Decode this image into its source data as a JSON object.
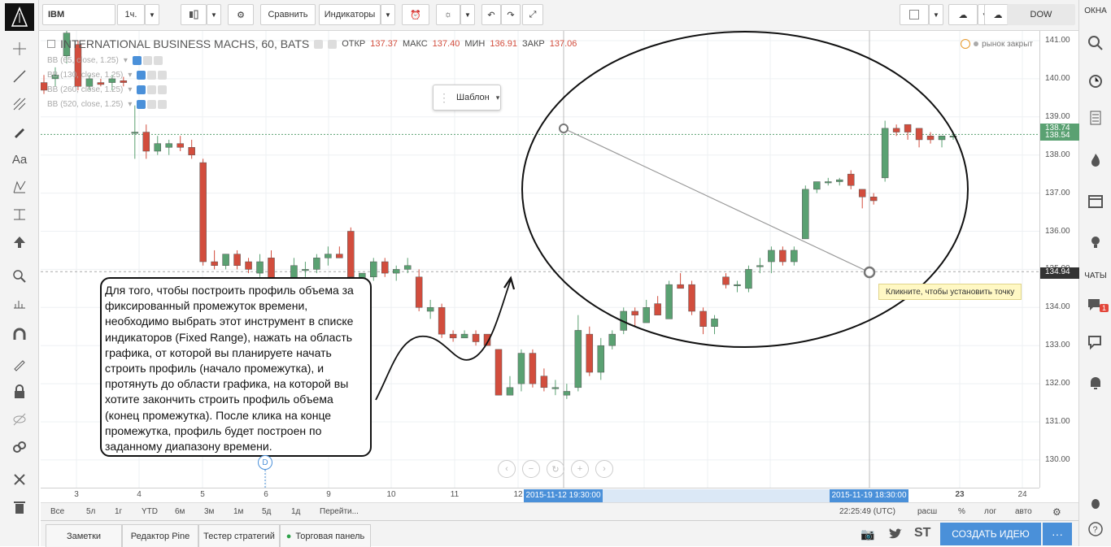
{
  "toolbar": {
    "symbol": "IBM",
    "interval": "1ч.",
    "compare": "Сравнить",
    "indicators": "Индикаторы",
    "exchange": "DOW"
  },
  "right_panel": {
    "windows_label": "ОКНА",
    "chats_label": "ЧАТЫ",
    "badge": "1"
  },
  "legend": {
    "title": "INTERNATIONAL BUSINESS MACHS, 60, BATS",
    "open_label": "ОТКР",
    "open": "137.37",
    "high_label": "МАКС",
    "high": "137.40",
    "low_label": "МИН",
    "low": "136.91",
    "close_label": "ЗАКР",
    "close": "137.06",
    "market_status": "рынок закрыт",
    "indicators": [
      "BB (65, close, 1.25)",
      "BB (130, close, 1.25)",
      "BB (260, close, 1.25)",
      "BB (520, close, 1.25)"
    ]
  },
  "template_button": "Шаблон",
  "tooltip": "Кликните, чтобы установить точку",
  "callout": "Для того, чтобы построить профиль объема за фиксированный промежуток времени, необходимо выбрать этот инструмент в списке индикаторов (Fixed Range), нажать на область графика, от которой вы планируете начать строить профиль (начало промежутка), и протянуть до области графика, на которой вы хотите закончить строить профиль объема (конец промежутка). После клика на конце промежутка, профиль будет построен по заданному диапазону времени.",
  "price_axis": {
    "ticks": [
      "141.00",
      "140.00",
      "139.00",
      "138.00",
      "137.00",
      "136.00",
      "135.00",
      "134.00",
      "133.00",
      "132.00",
      "131.00",
      "130.00"
    ],
    "label_top": "138.74",
    "label_top2": "138.54",
    "label_cursor": "134.94"
  },
  "time_axis": {
    "ticks": [
      "3",
      "4",
      "5",
      "6",
      "9",
      "10",
      "11",
      "12",
      "16",
      "17",
      "18",
      "23",
      "24"
    ],
    "label_start": "2015-11-12 19:30:00",
    "label_end": "2015-11-19 18:30:00"
  },
  "event_marker": "D",
  "range_buttons": [
    "Все",
    "5л",
    "1г",
    "YTD",
    "6м",
    "3м",
    "1м",
    "5д",
    "1д",
    "Перейти..."
  ],
  "clock": "22:25:49 (UTC)",
  "scale_buttons": [
    "расш",
    "%",
    "лог",
    "авто"
  ],
  "bottom_tabs": [
    "Заметки",
    "Редактор Pine",
    "Тестер стратегий",
    "Торговая панель"
  ],
  "social": {
    "st": "ST"
  },
  "create_idea": "СОЗДАТЬ ИДЕЮ",
  "more": "···",
  "colors": {
    "up": "#5aa172",
    "down": "#d24d3d",
    "accent": "#4a90d9",
    "create": "#4a90d9"
  },
  "chart_data": {
    "type": "candlestick",
    "title": "INTERNATIONAL BUSINESS MACHS, 60, BATS",
    "ylim": [
      129.3,
      141.2
    ],
    "candles": [
      {
        "o": 139.9,
        "h": 140.1,
        "l": 139.6,
        "c": 139.7
      },
      {
        "o": 140.0,
        "h": 140.3,
        "l": 139.8,
        "c": 140.1
      },
      {
        "o": 140.6,
        "h": 141.3,
        "l": 140.4,
        "c": 141.2
      },
      {
        "o": 140.9,
        "h": 141.0,
        "l": 139.7,
        "c": 139.8
      },
      {
        "o": 139.8,
        "h": 140.1,
        "l": 139.7,
        "c": 140.0
      },
      {
        "o": 139.9,
        "h": 140.0,
        "l": 139.8,
        "c": 139.85
      },
      {
        "o": 139.9,
        "h": 140.1,
        "l": 139.7,
        "c": 140.0
      },
      {
        "o": 139.95,
        "h": 140.05,
        "l": 139.8,
        "c": 139.9
      },
      {
        "o": 138.6,
        "h": 139.3,
        "l": 137.9,
        "c": 138.6
      },
      {
        "o": 138.6,
        "h": 138.8,
        "l": 137.9,
        "c": 138.1
      },
      {
        "o": 138.1,
        "h": 138.5,
        "l": 138.0,
        "c": 138.3
      },
      {
        "o": 138.2,
        "h": 138.4,
        "l": 138.0,
        "c": 138.3
      },
      {
        "o": 138.3,
        "h": 138.5,
        "l": 138.1,
        "c": 138.2
      },
      {
        "o": 138.2,
        "h": 138.4,
        "l": 137.9,
        "c": 138.0
      },
      {
        "o": 137.8,
        "h": 137.9,
        "l": 135.1,
        "c": 135.2
      },
      {
        "o": 135.2,
        "h": 135.5,
        "l": 135.0,
        "c": 135.1
      },
      {
        "o": 135.1,
        "h": 135.4,
        "l": 135.0,
        "c": 135.4
      },
      {
        "o": 135.4,
        "h": 135.5,
        "l": 135.0,
        "c": 135.1
      },
      {
        "o": 135.2,
        "h": 135.3,
        "l": 134.9,
        "c": 135.0
      },
      {
        "o": 134.9,
        "h": 135.4,
        "l": 134.8,
        "c": 135.2
      },
      {
        "o": 135.3,
        "h": 135.5,
        "l": 134.1,
        "c": 134.1
      },
      {
        "o": 134.2,
        "h": 134.5,
        "l": 134.1,
        "c": 134.3
      },
      {
        "o": 134.4,
        "h": 135.3,
        "l": 134.4,
        "c": 135.1
      },
      {
        "o": 135.0,
        "h": 135.2,
        "l": 134.8,
        "c": 135.0
      },
      {
        "o": 135.0,
        "h": 135.4,
        "l": 134.9,
        "c": 135.3
      },
      {
        "o": 135.3,
        "h": 135.6,
        "l": 135.1,
        "c": 135.4
      },
      {
        "o": 135.4,
        "h": 135.6,
        "l": 135.3,
        "c": 135.3
      },
      {
        "o": 136.0,
        "h": 136.1,
        "l": 134.7,
        "c": 134.8
      },
      {
        "o": 134.7,
        "h": 134.9,
        "l": 134.5,
        "c": 134.9
      },
      {
        "o": 134.8,
        "h": 135.3,
        "l": 134.7,
        "c": 135.2
      },
      {
        "o": 135.2,
        "h": 135.3,
        "l": 134.8,
        "c": 134.9
      },
      {
        "o": 134.9,
        "h": 135.1,
        "l": 134.7,
        "c": 135.0
      },
      {
        "o": 135.0,
        "h": 135.3,
        "l": 134.9,
        "c": 135.1
      },
      {
        "o": 134.8,
        "h": 135.0,
        "l": 133.9,
        "c": 134.0
      },
      {
        "o": 133.9,
        "h": 134.2,
        "l": 133.7,
        "c": 134.0
      },
      {
        "o": 134.0,
        "h": 134.1,
        "l": 133.2,
        "c": 133.3
      },
      {
        "o": 133.3,
        "h": 133.4,
        "l": 133.1,
        "c": 133.2
      },
      {
        "o": 133.2,
        "h": 133.4,
        "l": 133.2,
        "c": 133.3
      },
      {
        "o": 133.3,
        "h": 133.4,
        "l": 133.0,
        "c": 133.1
      },
      {
        "o": 133.3,
        "h": 133.3,
        "l": 133.0,
        "c": 133.0
      },
      {
        "o": 132.9,
        "h": 132.9,
        "l": 131.7,
        "c": 131.7
      },
      {
        "o": 131.7,
        "h": 132.2,
        "l": 131.7,
        "c": 131.9
      },
      {
        "o": 132.0,
        "h": 132.9,
        "l": 131.8,
        "c": 132.8
      },
      {
        "o": 132.8,
        "h": 132.9,
        "l": 131.9,
        "c": 132.0
      },
      {
        "o": 132.2,
        "h": 132.4,
        "l": 131.8,
        "c": 131.9
      },
      {
        "o": 131.9,
        "h": 132.1,
        "l": 131.7,
        "c": 131.9
      },
      {
        "o": 131.7,
        "h": 132.0,
        "l": 131.6,
        "c": 131.8
      },
      {
        "o": 131.9,
        "h": 133.8,
        "l": 131.8,
        "c": 133.4
      },
      {
        "o": 133.3,
        "h": 133.5,
        "l": 132.2,
        "c": 132.3
      },
      {
        "o": 132.3,
        "h": 133.2,
        "l": 132.1,
        "c": 133.0
      },
      {
        "o": 133.0,
        "h": 133.4,
        "l": 132.9,
        "c": 133.3
      },
      {
        "o": 133.4,
        "h": 134.0,
        "l": 133.3,
        "c": 133.9
      },
      {
        "o": 133.9,
        "h": 134.0,
        "l": 133.5,
        "c": 133.8
      },
      {
        "o": 133.6,
        "h": 134.2,
        "l": 133.6,
        "c": 134.0
      },
      {
        "o": 134.1,
        "h": 134.3,
        "l": 133.8,
        "c": 133.8
      },
      {
        "o": 133.7,
        "h": 134.7,
        "l": 133.7,
        "c": 134.6
      },
      {
        "o": 134.6,
        "h": 134.9,
        "l": 134.5,
        "c": 134.5
      },
      {
        "o": 134.6,
        "h": 134.7,
        "l": 133.8,
        "c": 133.9
      },
      {
        "o": 133.9,
        "h": 134.0,
        "l": 133.3,
        "c": 133.5
      },
      {
        "o": 133.5,
        "h": 133.8,
        "l": 133.3,
        "c": 133.7
      },
      {
        "o": 134.8,
        "h": 134.9,
        "l": 134.5,
        "c": 134.6
      },
      {
        "o": 134.6,
        "h": 134.7,
        "l": 134.4,
        "c": 134.6
      },
      {
        "o": 134.5,
        "h": 135.1,
        "l": 134.4,
        "c": 135.0
      },
      {
        "o": 135.1,
        "h": 135.3,
        "l": 134.9,
        "c": 135.1
      },
      {
        "o": 135.2,
        "h": 135.6,
        "l": 134.9,
        "c": 135.5
      },
      {
        "o": 135.5,
        "h": 135.6,
        "l": 135.1,
        "c": 135.2
      },
      {
        "o": 135.2,
        "h": 135.6,
        "l": 135.1,
        "c": 135.5
      },
      {
        "o": 135.8,
        "h": 137.2,
        "l": 135.8,
        "c": 137.1
      },
      {
        "o": 137.1,
        "h": 137.3,
        "l": 137.0,
        "c": 137.3
      },
      {
        "o": 137.3,
        "h": 137.4,
        "l": 137.2,
        "c": 137.3
      },
      {
        "o": 137.3,
        "h": 137.4,
        "l": 137.2,
        "c": 137.35
      },
      {
        "o": 137.5,
        "h": 137.6,
        "l": 137.1,
        "c": 137.2
      },
      {
        "o": 137.1,
        "h": 137.1,
        "l": 136.6,
        "c": 136.9
      },
      {
        "o": 136.9,
        "h": 137.0,
        "l": 136.7,
        "c": 136.8
      },
      {
        "o": 137.4,
        "h": 138.9,
        "l": 137.3,
        "c": 138.7
      },
      {
        "o": 138.7,
        "h": 138.8,
        "l": 138.5,
        "c": 138.6
      },
      {
        "o": 138.8,
        "h": 138.8,
        "l": 138.4,
        "c": 138.6
      },
      {
        "o": 138.7,
        "h": 138.7,
        "l": 138.2,
        "c": 138.4
      },
      {
        "o": 138.5,
        "h": 138.6,
        "l": 138.3,
        "c": 138.4
      },
      {
        "o": 138.4,
        "h": 138.5,
        "l": 138.2,
        "c": 138.5
      },
      {
        "o": 138.5,
        "h": 138.6,
        "l": 138.4,
        "c": 138.5
      }
    ]
  }
}
